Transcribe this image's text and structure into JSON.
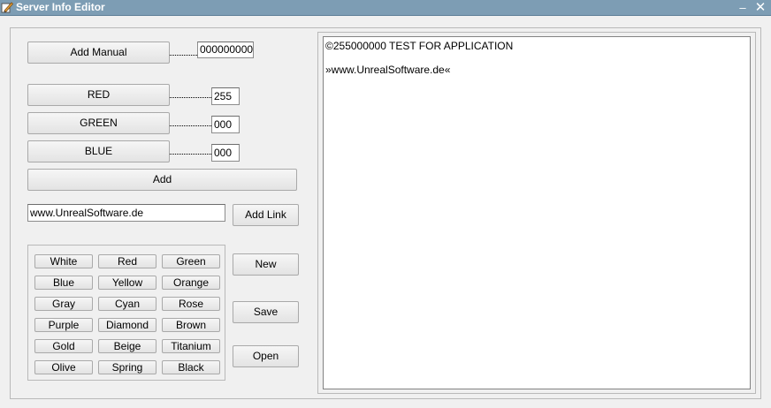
{
  "window": {
    "title": "Server Info Editor",
    "minimize_glyph": "–",
    "close_glyph": "✕"
  },
  "controls": {
    "add_manual_label": "Add Manual",
    "manual_value": "000000000",
    "red_label": "RED",
    "red_value": "255",
    "green_label": "GREEN",
    "green_value": "000",
    "blue_label": "BLUE",
    "blue_value": "000",
    "add_label": "Add",
    "link_value": "www.UnrealSoftware.de",
    "add_link_label": "Add Link"
  },
  "palette": [
    [
      "White",
      "Red",
      "Green"
    ],
    [
      "Blue",
      "Yellow",
      "Orange"
    ],
    [
      "Gray",
      "Cyan",
      "Rose"
    ],
    [
      "Purple",
      "Diamond",
      "Brown"
    ],
    [
      "Gold",
      "Beige",
      "Titanium"
    ],
    [
      "Olive",
      "Spring",
      "Black"
    ]
  ],
  "file_buttons": {
    "new_label": "New",
    "save_label": "Save",
    "open_label": "Open"
  },
  "preview": {
    "line1": "©255000000 TEST FOR APPLICATION",
    "line2": "»www.UnrealSoftware.de«"
  },
  "colors": {
    "titlebar": "#7d9db4",
    "window_bg": "#f0f0f0"
  }
}
